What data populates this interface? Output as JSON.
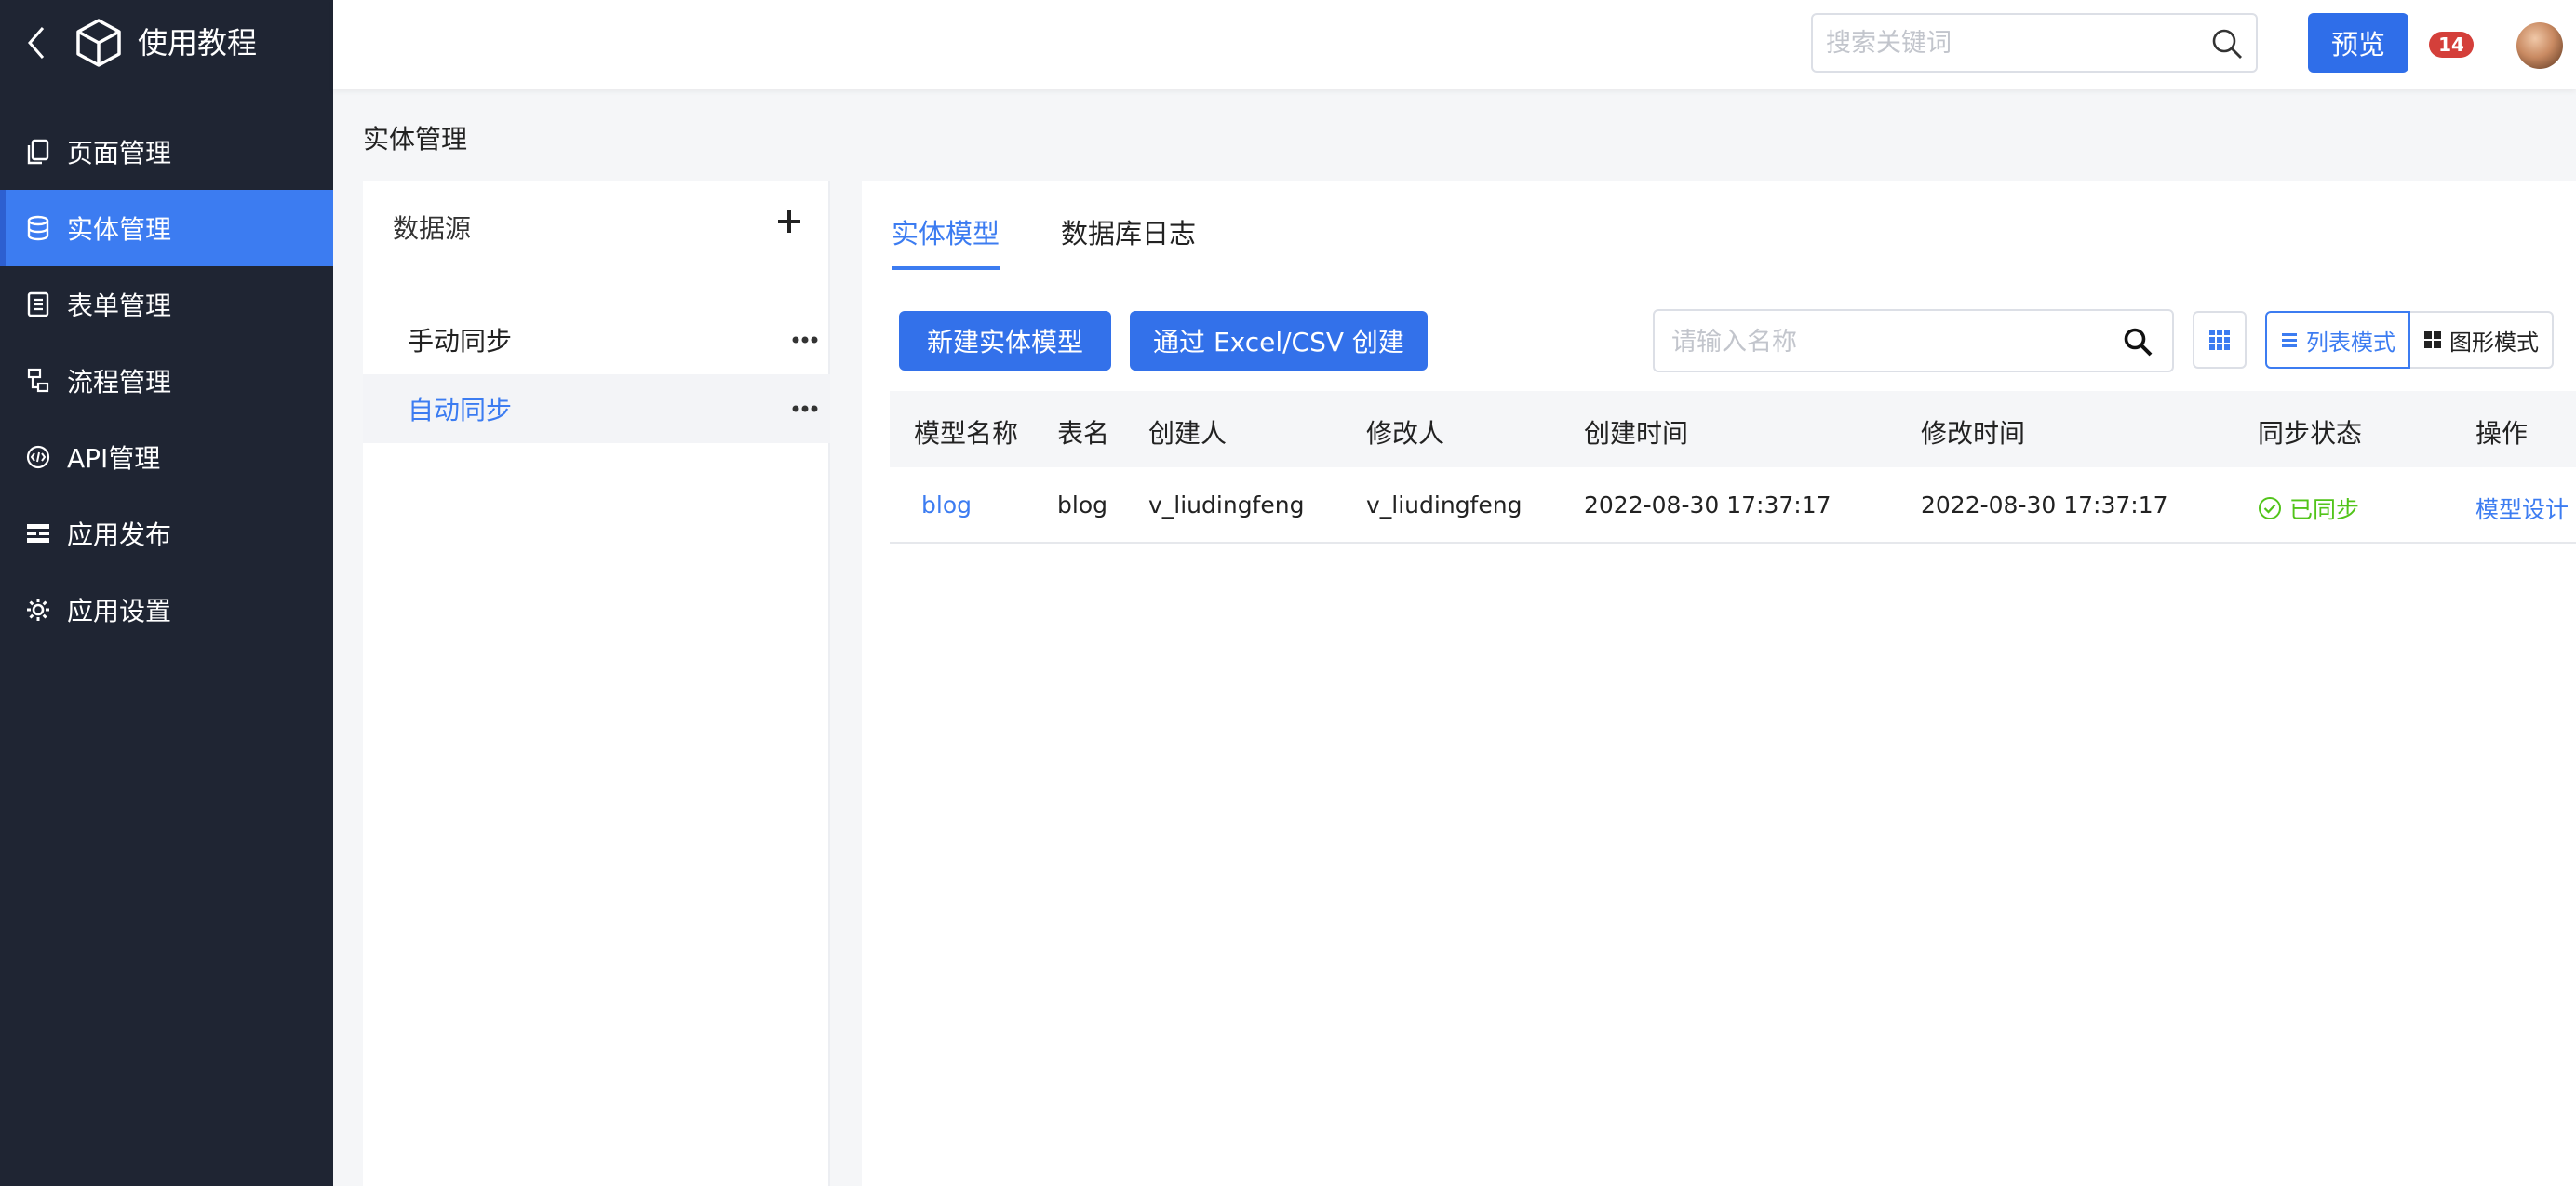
{
  "app": {
    "title": "使用教程"
  },
  "sidebar": {
    "items": [
      {
        "label": "页面管理",
        "icon": "pages-icon",
        "active": false
      },
      {
        "label": "实体管理",
        "icon": "database-icon",
        "active": true
      },
      {
        "label": "表单管理",
        "icon": "form-icon",
        "active": false
      },
      {
        "label": "流程管理",
        "icon": "workflow-icon",
        "active": false
      },
      {
        "label": "API管理",
        "icon": "api-icon",
        "active": false
      },
      {
        "label": "应用发布",
        "icon": "publish-icon",
        "active": false
      },
      {
        "label": "应用设置",
        "icon": "gear-icon",
        "active": false
      }
    ]
  },
  "topbar": {
    "search_placeholder": "搜索关键词",
    "preview_label": "预览",
    "notification_count": "14"
  },
  "page": {
    "title": "实体管理"
  },
  "datasource": {
    "header": "数据源",
    "items": [
      {
        "label": "手动同步",
        "active": false
      },
      {
        "label": "自动同步",
        "active": true
      }
    ]
  },
  "main": {
    "tabs": [
      {
        "label": "实体模型",
        "active": true
      },
      {
        "label": "数据库日志",
        "active": false
      }
    ],
    "new_model_label": "新建实体模型",
    "excel_create_label": "通过 Excel/CSV 创建",
    "name_search_placeholder": "请输入名称",
    "list_mode_label": "列表模式",
    "graph_mode_label": "图形模式"
  },
  "table": {
    "columns": [
      "模型名称",
      "表名",
      "创建人",
      "修改人",
      "创建时间",
      "修改时间",
      "同步状态",
      "操作"
    ],
    "rows": [
      {
        "model_name": "blog",
        "table_name": "blog",
        "creator": "v_liudingfeng",
        "modifier": "v_liudingfeng",
        "created_at": "2022-08-30 17:37:17",
        "modified_at": "2022-08-30 17:37:17",
        "sync_status": "已同步",
        "action": "模型设计"
      }
    ]
  },
  "colors": {
    "sidebar_bg": "#1f2533",
    "accent": "#3c7cf1",
    "success": "#52c41a",
    "badge": "#d43f3a"
  }
}
